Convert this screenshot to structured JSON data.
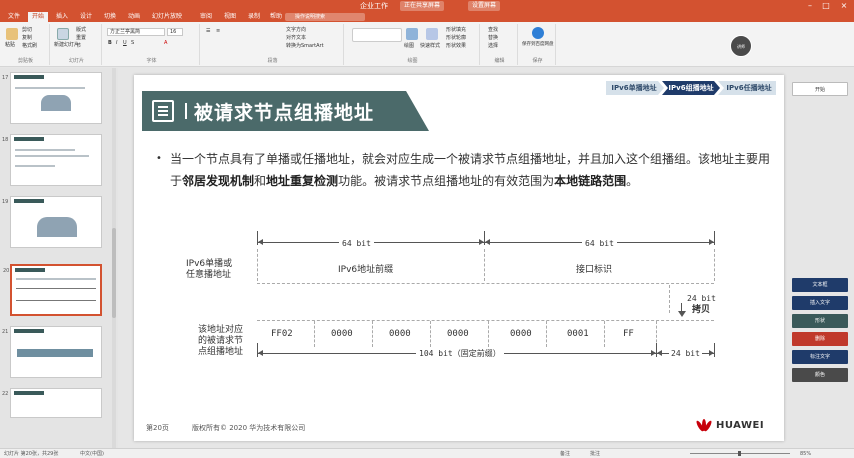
{
  "window": {
    "title": "企业工作",
    "pill_left": "正在共享屏幕",
    "pill_right": "设置屏幕",
    "ctl_min": "–",
    "ctl_max": "□",
    "ctl_close": "×"
  },
  "tabs": [
    "文件",
    "开始",
    "插入",
    "设计",
    "切换",
    "动画",
    "幻灯片放映",
    "审阅",
    "视图",
    "录制",
    "帮助"
  ],
  "active_tab_index": 1,
  "search_placeholder": "操作说明搜索",
  "ribbon": {
    "paste": "粘贴",
    "cut": "剪切",
    "copy": "复制",
    "format_painter": "格式刷",
    "new_slide": "新建幻灯片",
    "layout": "版式",
    "reset": "重置",
    "section": "节",
    "font_name": "方正兰亭黑简",
    "font_size": "16",
    "text_direction": "文字方向",
    "align_text": "对齐文本",
    "convert_smartart": "转换为SmartArt",
    "draw": "绘图",
    "quick_styles": "快速样式",
    "shape_fill": "形状填充",
    "shape_outline": "形状轮廓",
    "shape_effects": "形状效果",
    "find": "查找",
    "replace": "替换",
    "select": "选择",
    "editing": "编辑",
    "save_to": "保存到百度网盘",
    "save_group": "保存",
    "groups": [
      "剪贴板",
      "幻灯片",
      "字体",
      "段落",
      "绘图",
      "编辑",
      "保存"
    ]
  },
  "thumbnails": [
    {
      "num": "17"
    },
    {
      "num": "18"
    },
    {
      "num": "19"
    },
    {
      "num": "20"
    },
    {
      "num": "21"
    },
    {
      "num": "22"
    }
  ],
  "selected_thumbnail": 3,
  "slide": {
    "title": "被请求节点组播地址",
    "breadcrumbs": [
      "IPv6单播地址",
      "IPv6组播地址",
      "IPv6任播地址"
    ],
    "active_crumb": 1,
    "bullet": {
      "part1": "当一个节点具有了单播或任播地址，就会对应生成一个被请求节点组播地址，并且加入这个组播组。该地址主要用于",
      "bold1": "邻居发现机制",
      "part2": "和",
      "bold2": "地址重复检测",
      "part3": "功能。被请求节点组播地址的有效范围为",
      "bold3": "本地链路范围",
      "part4": "。"
    },
    "diagram": {
      "top_left_label_1": "IPv6单播或",
      "top_left_label_2": "任意播地址",
      "bit64_a": "64 bit",
      "bit64_b": "64 bit",
      "prefix_label": "IPv6地址前缀",
      "iface_label": "接口标识",
      "bit24_top": "24 bit",
      "copy_label": "拷贝",
      "bottom_left_label_1": "该地址对应",
      "bottom_left_label_2": "的被请求节",
      "bottom_left_label_3": "点组播地址",
      "groups": [
        "FF02",
        "0000",
        "0000",
        "0000",
        "0000",
        "0001",
        "FF"
      ],
      "bit104": "104 bit（固定前缀）",
      "bit24_bottom": "24 bit"
    },
    "footer_page": "第20页",
    "footer_copy": "版权所有© 2020 华为技术有限公司",
    "logo_text": "HUAWEI"
  },
  "right_panel": {
    "top_btn": "开始",
    "items": [
      "文本框",
      "插入文字",
      "形状",
      "删除",
      "标注文字",
      "颜色"
    ]
  },
  "status": {
    "slide_info": "幻灯片 第20张，共29张",
    "lang": "中文(中国)",
    "notes": "备注",
    "comments": "批注",
    "zoom": "85%"
  },
  "webcam_label": "讲师"
}
